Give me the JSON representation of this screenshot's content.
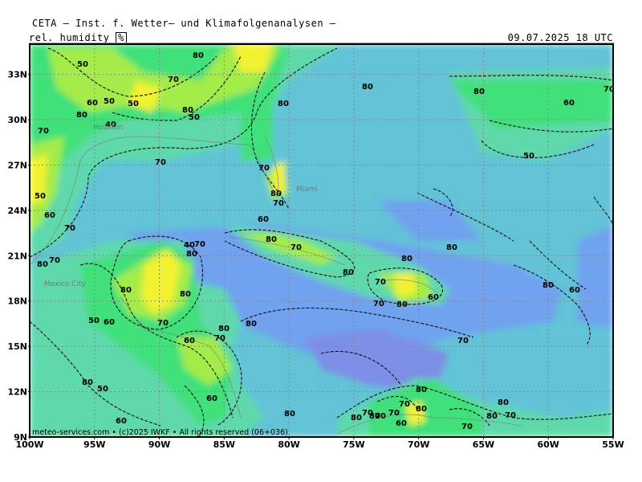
{
  "header": {
    "title": "CETA — Inst. f. Wetter— und Klimafolgenanalysen —",
    "variable": "rel. humidity",
    "unit": "%",
    "valid_time": "09.07.2025 18 UTC"
  },
  "map": {
    "lat_range": [
      9,
      35
    ],
    "lon_range": [
      -100,
      -55
    ],
    "lat_labels": [
      "33N",
      "30N",
      "27N",
      "24N",
      "21N",
      "18N",
      "15N",
      "12N",
      "9N"
    ],
    "lon_labels": [
      "100W",
      "95W",
      "90W",
      "85W",
      "80W",
      "75W",
      "70W",
      "65W",
      "60W",
      "55W"
    ],
    "colors": {
      "very_moist": "#7d8fe6",
      "moist": "#6fa2ef",
      "med_moist": "#62c3d6",
      "medium": "#5fd9ab",
      "med_dry": "#40e07a",
      "dry": "#a3ec4a",
      "very_dry": "#f2f233"
    },
    "cities": [
      "Houston",
      "Miami",
      "Mexico City"
    ],
    "contour_labels": [
      "50",
      "70",
      "80",
      "60",
      "50",
      "80",
      "50",
      "80",
      "70",
      "50",
      "80",
      "40",
      "50",
      "60",
      "70",
      "70",
      "80",
      "80",
      "60",
      "70",
      "70",
      "80",
      "70",
      "50",
      "60",
      "80",
      "70",
      "40",
      "80",
      "70",
      "80",
      "70",
      "80",
      "80",
      "80",
      "70",
      "70",
      "80",
      "60",
      "80",
      "60",
      "80",
      "80",
      "50",
      "60",
      "70",
      "80",
      "60",
      "70",
      "80",
      "70",
      "60",
      "80",
      "50",
      "60",
      "80",
      "70",
      "80",
      "70",
      "80",
      "80",
      "70",
      "80",
      "60",
      "70",
      "70",
      "80",
      "70",
      "80"
    ]
  },
  "footer": {
    "copyright": "meteo-services.com • (c)2025 IWKF • All rights reserved (06+036)"
  }
}
